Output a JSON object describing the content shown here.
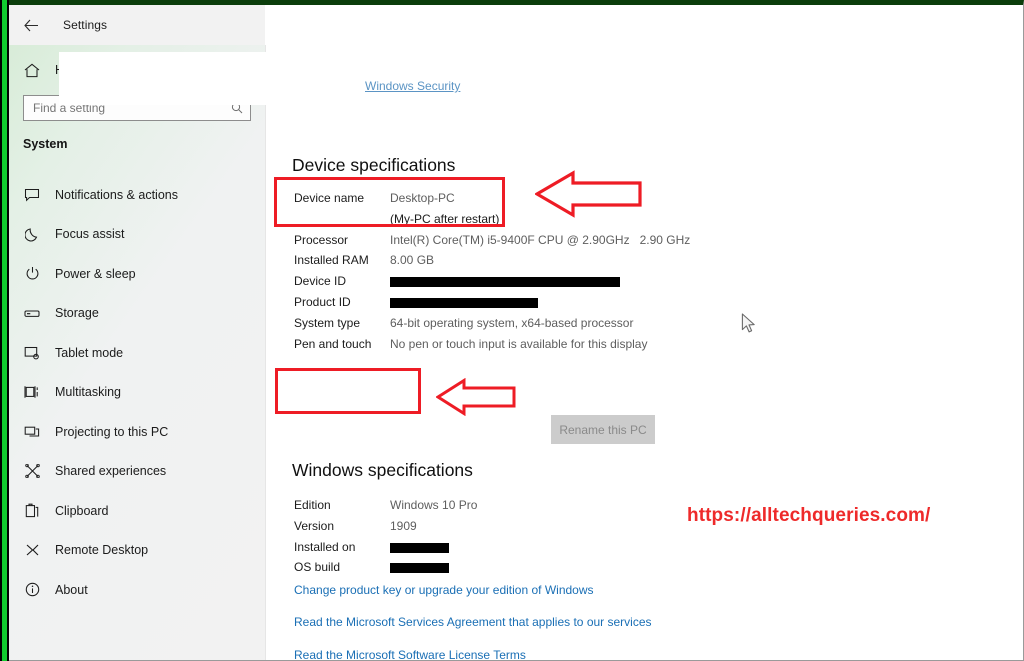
{
  "window": {
    "title": "Settings",
    "back_label": "←",
    "back_icon": "back-arrow-icon"
  },
  "nav": {
    "home_label": "Home",
    "home_icon": "home-icon",
    "search": {
      "placeholder": "Find a setting",
      "value": "",
      "icon": "search-icon"
    },
    "heading": "System",
    "items": [
      {
        "label": "Notifications & actions",
        "icon": "notification-icon"
      },
      {
        "label": "Focus assist",
        "icon": "moon-icon"
      },
      {
        "label": "Power & sleep",
        "icon": "power-icon"
      },
      {
        "label": "Storage",
        "icon": "storage-icon"
      },
      {
        "label": "Tablet mode",
        "icon": "tablet-icon"
      },
      {
        "label": "Multitasking",
        "icon": "multitasking-icon"
      },
      {
        "label": "Projecting to this PC",
        "icon": "projecting-icon"
      },
      {
        "label": "Shared experiences",
        "icon": "share-icon"
      },
      {
        "label": "Clipboard",
        "icon": "clipboard-icon"
      },
      {
        "label": "Remote Desktop",
        "icon": "remote-desktop-icon"
      },
      {
        "label": "About",
        "icon": "info-icon"
      }
    ]
  },
  "content": {
    "windows_security_link": "Windows Security",
    "device_specs": {
      "title": "Device specifications",
      "rows": [
        {
          "key": "Device name",
          "value": "Desktop-PC",
          "redacted": false
        },
        {
          "key": "",
          "value": "(My-PC after restart)",
          "redacted": false,
          "dark": true
        },
        {
          "key": "Processor",
          "value": "Intel(R) Core(TM) i5-9400F CPU @ 2.90GHz   2.90 GHz",
          "redacted": false
        },
        {
          "key": "Installed RAM",
          "value": "8.00 GB",
          "redacted": false
        },
        {
          "key": "Device ID",
          "value": "",
          "redacted": true,
          "redact_width": 230
        },
        {
          "key": "Product ID",
          "value": "",
          "redacted": true,
          "redact_width": 148
        },
        {
          "key": "System type",
          "value": "64-bit operating system, x64-based processor",
          "redacted": false
        },
        {
          "key": "Pen and touch",
          "value": "No pen or touch input is available for this display",
          "redacted": false
        }
      ],
      "rename_button": "Rename this PC"
    },
    "windows_specs": {
      "title": "Windows specifications",
      "rows": [
        {
          "key": "Edition",
          "value": "Windows 10 Pro",
          "redacted": false
        },
        {
          "key": "Version",
          "value": "1909",
          "redacted": false
        },
        {
          "key": "Installed on",
          "value": "",
          "redacted": true,
          "redact_width": 59
        },
        {
          "key": "OS build",
          "value": "",
          "redacted": true,
          "redact_width": 59
        }
      ],
      "links": [
        "Change product key or upgrade your edition of Windows",
        "Read the Microsoft Services Agreement that applies to our services",
        "Read the Microsoft Software License Terms"
      ]
    }
  },
  "annotations": {
    "watermark": "https://alltechqueries.com/",
    "accent_red": "#ee1c25",
    "link_blue": "#1a6fb5",
    "frame_green": "#11cc2f"
  }
}
